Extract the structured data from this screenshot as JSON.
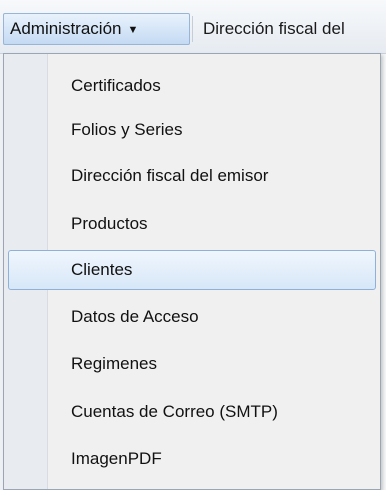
{
  "toolbar": {
    "menu_label": "Administración",
    "next_item_label": "Dirección fiscal del"
  },
  "dropdown": {
    "items": [
      {
        "label": "Certificados",
        "active": false
      },
      {
        "label": "Folios y Series",
        "active": false
      },
      {
        "label": "Dirección fiscal del emisor",
        "active": false
      },
      {
        "label": "Productos",
        "active": false
      },
      {
        "label": "Clientes",
        "active": true
      },
      {
        "label": "Datos de Acceso",
        "active": false
      },
      {
        "label": "Regimenes",
        "active": false
      },
      {
        "label": "Cuentas de Correo (SMTP)",
        "active": false
      },
      {
        "label": "ImagenPDF",
        "active": false
      }
    ]
  },
  "icons": {
    "caret": "chevron-down-icon"
  },
  "colors": {
    "highlight_border": "#8fb1d9",
    "highlight_fill": "#d7e7f8",
    "menu_background": "#f0f0f0"
  }
}
